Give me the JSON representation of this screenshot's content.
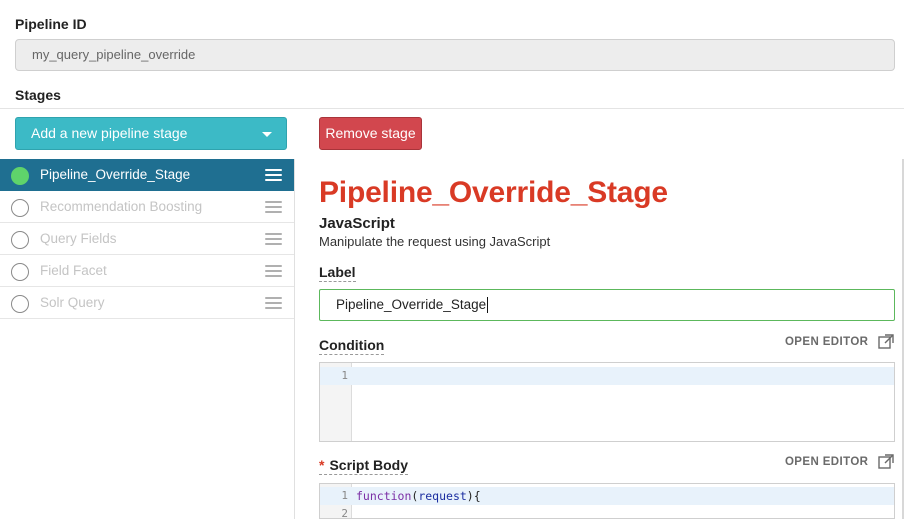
{
  "pipeline": {
    "id_label": "Pipeline ID",
    "id_value": "my_query_pipeline_override"
  },
  "stages_section": {
    "label": "Stages",
    "add_button": "Add a new pipeline stage",
    "remove_button": "Remove stage"
  },
  "stage_list": [
    {
      "name": "Pipeline_Override_Stage",
      "active": true
    },
    {
      "name": "Recommendation Boosting",
      "active": false
    },
    {
      "name": "Query Fields",
      "active": false
    },
    {
      "name": "Field Facet",
      "active": false
    },
    {
      "name": "Solr Query",
      "active": false
    }
  ],
  "detail": {
    "title": "Pipeline_Override_Stage",
    "type": "JavaScript",
    "description": "Manipulate the request using JavaScript",
    "label_field": {
      "label": "Label",
      "value": "Pipeline_Override_Stage"
    },
    "condition_field": {
      "label": "Condition",
      "open_editor": "OPEN EDITOR",
      "line_numbers": [
        "1"
      ]
    },
    "script_field": {
      "required_mark": "*",
      "label": "Script Body",
      "open_editor": "OPEN EDITOR",
      "line_numbers": [
        "1",
        "2"
      ],
      "code": {
        "keyword": "function",
        "open_paren": "(",
        "param": "request",
        "close": "){"
      }
    }
  },
  "colors": {
    "accent_teal": "#3cbac6",
    "danger": "#d2474e",
    "title_red": "#d93a25",
    "active_row": "#1f6f91",
    "active_dot": "#5fd36b",
    "focus_green": "#5cb85c"
  }
}
